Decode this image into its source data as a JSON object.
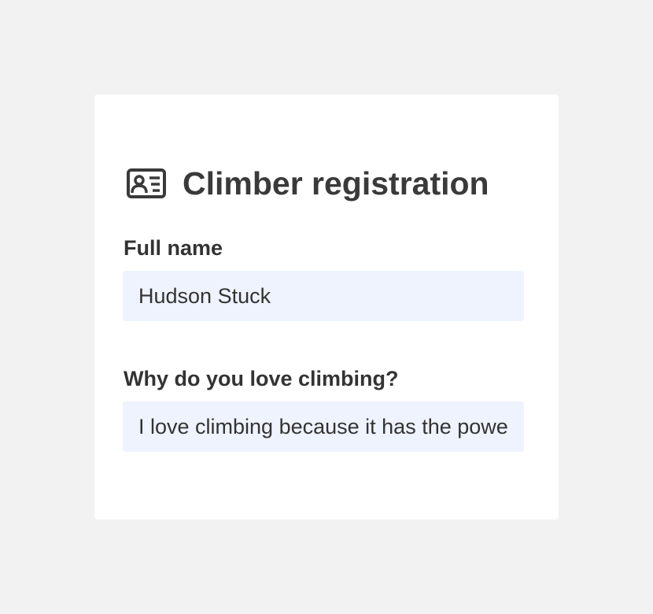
{
  "form": {
    "icon": "id-card-icon",
    "title": "Climber registration",
    "fields": [
      {
        "label": "Full name",
        "value": "Hudson Stuck"
      },
      {
        "label": "Why do you love climbing?",
        "value": "I love climbing because it has the powe"
      }
    ]
  },
  "colors": {
    "page_background": "#f2f2f2",
    "card_background": "#ffffff",
    "input_background": "#eef3fd",
    "text": "#333333",
    "title_text": "#3a3a3a"
  }
}
